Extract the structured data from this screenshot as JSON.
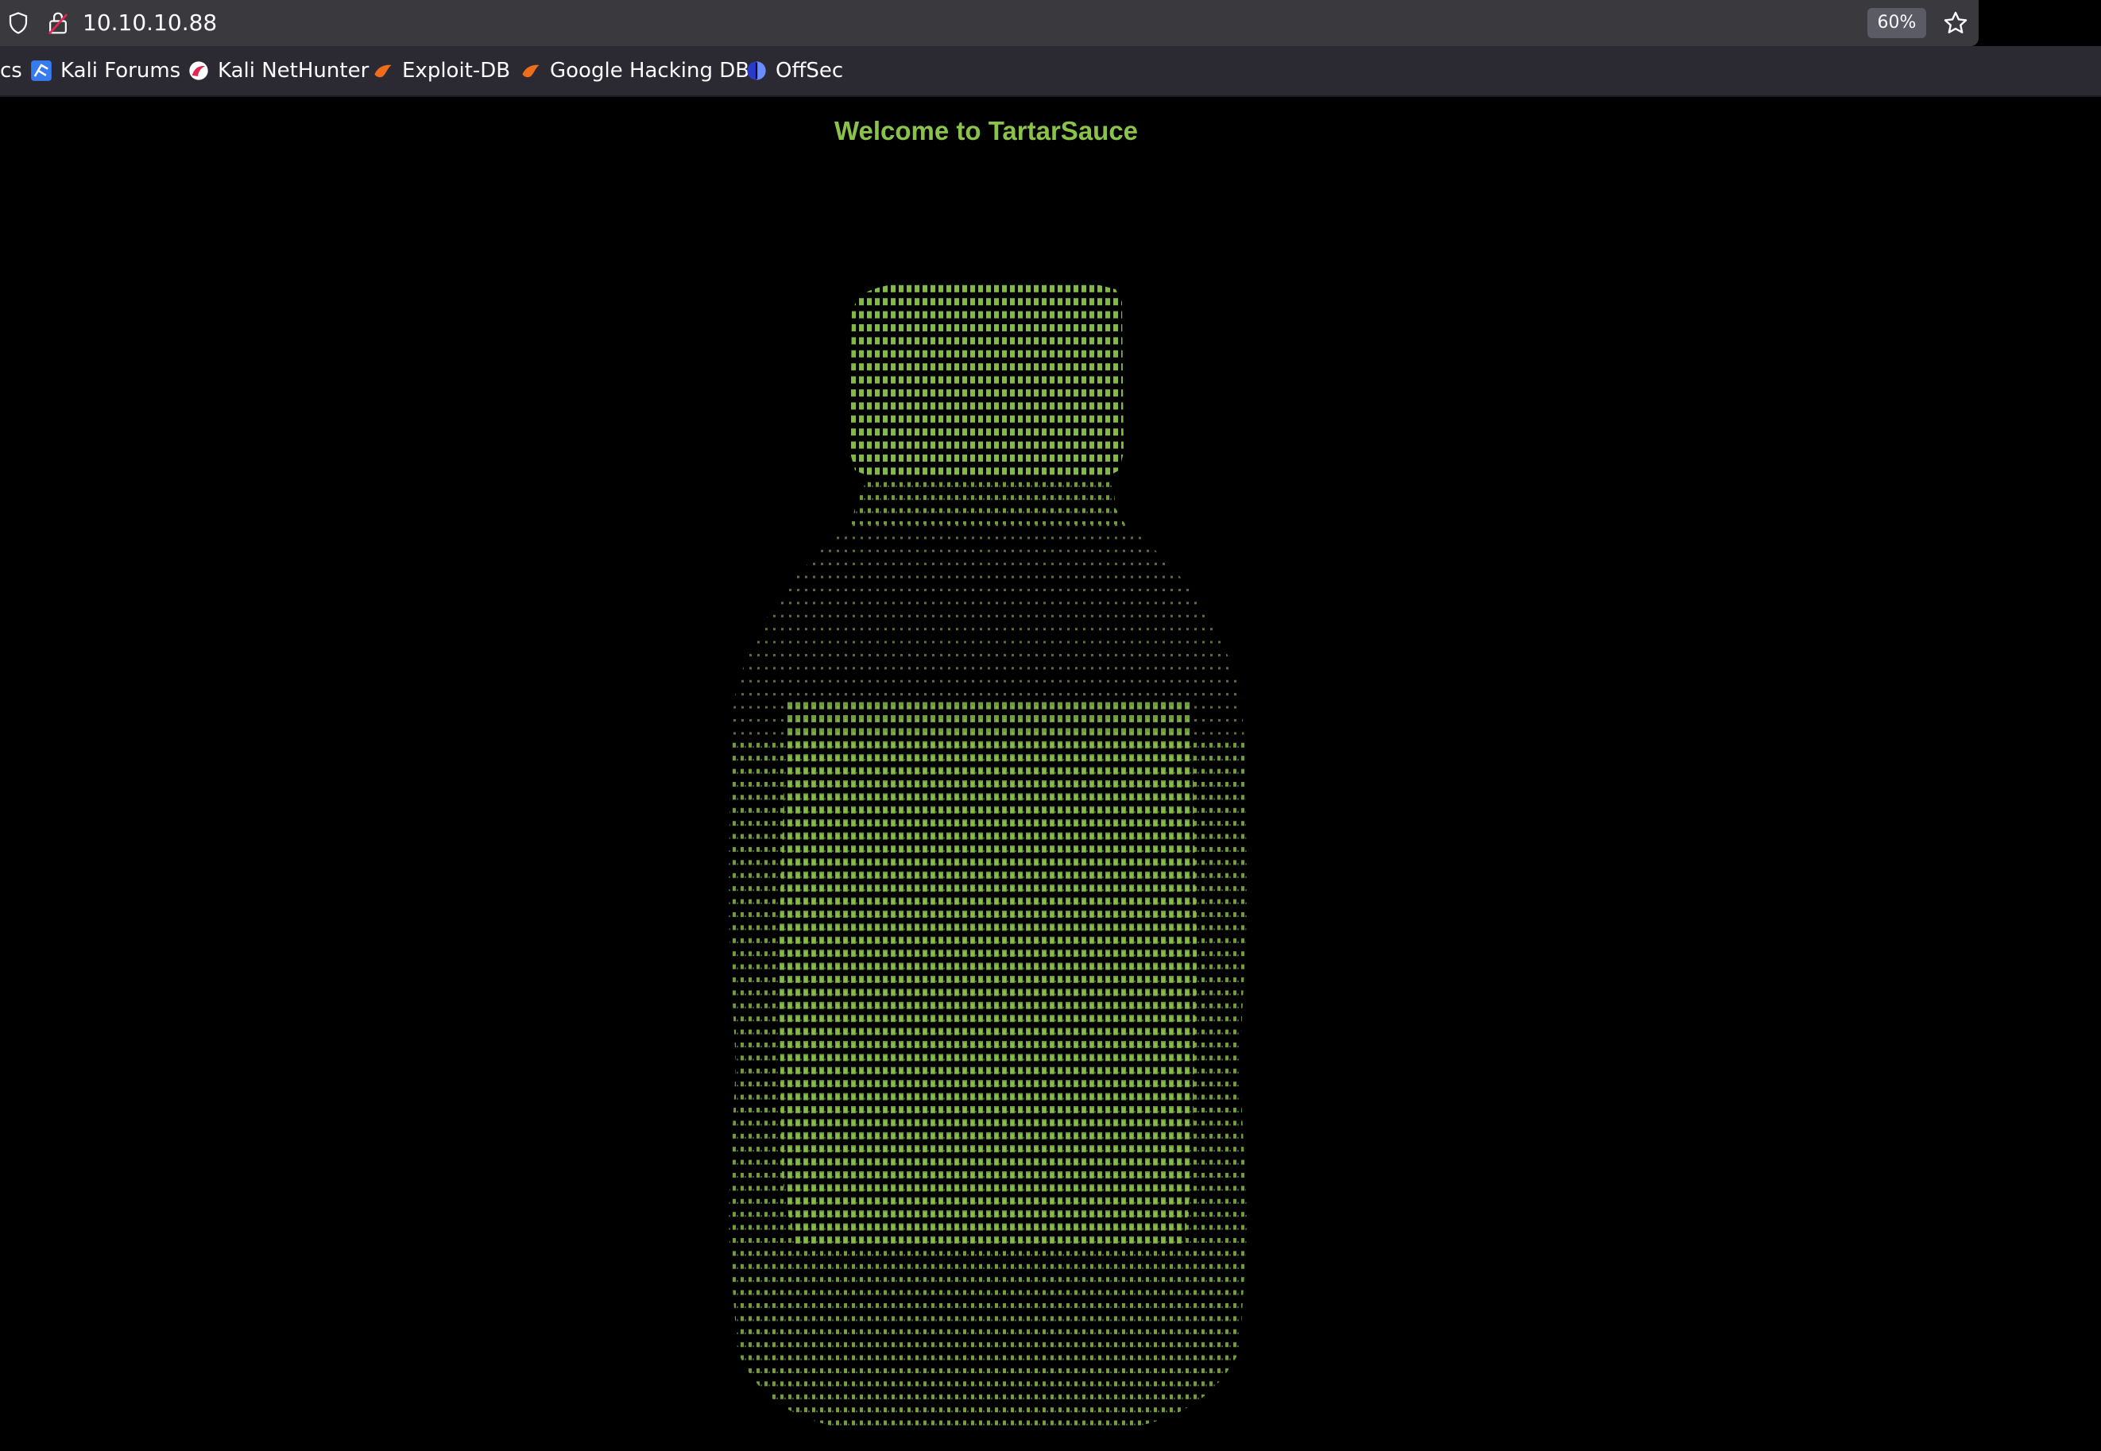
{
  "browser": {
    "url": "10.10.10.88",
    "zoom": "60%",
    "icons": [
      "shield-icon",
      "lock-icon",
      "star-icon"
    ]
  },
  "bookmarks": [
    {
      "label": "cs",
      "icon": "none"
    },
    {
      "label": "Kali Forums",
      "icon": "kali-dragon-icon"
    },
    {
      "label": "Kali NetHunter",
      "icon": "nethunter-icon"
    },
    {
      "label": "Exploit-DB",
      "icon": "exploit-db-icon"
    },
    {
      "label": "Google Hacking DB",
      "icon": "exploit-db-icon"
    },
    {
      "label": "OffSec",
      "icon": "offsec-icon"
    }
  ],
  "page": {
    "title": "Welcome to TartarSauce",
    "art_color": "#8bc34a",
    "art_description_icon": "sauce-bottle-ascii-art"
  }
}
